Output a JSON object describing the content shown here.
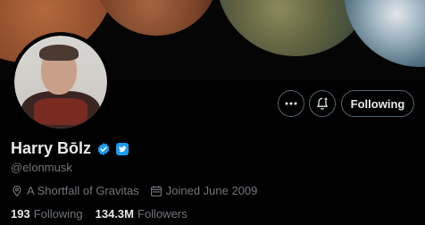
{
  "profile": {
    "name": "Harry Bōlz",
    "handle": "@elonmusk",
    "location": "A Shortfall of Gravitas",
    "joined": "Joined June 2009",
    "following_count": "193",
    "following_label": "Following",
    "followers_count": "134.3M",
    "followers_label": "Followers"
  },
  "actions": {
    "more_icon": "more-icon",
    "notify_icon": "notification-bell-icon",
    "follow_label": "Following"
  },
  "colors": {
    "background": "#000000",
    "text": "#e7e9ea",
    "muted": "#71767b",
    "border": "#536471",
    "verified": "#1d9bf0"
  }
}
